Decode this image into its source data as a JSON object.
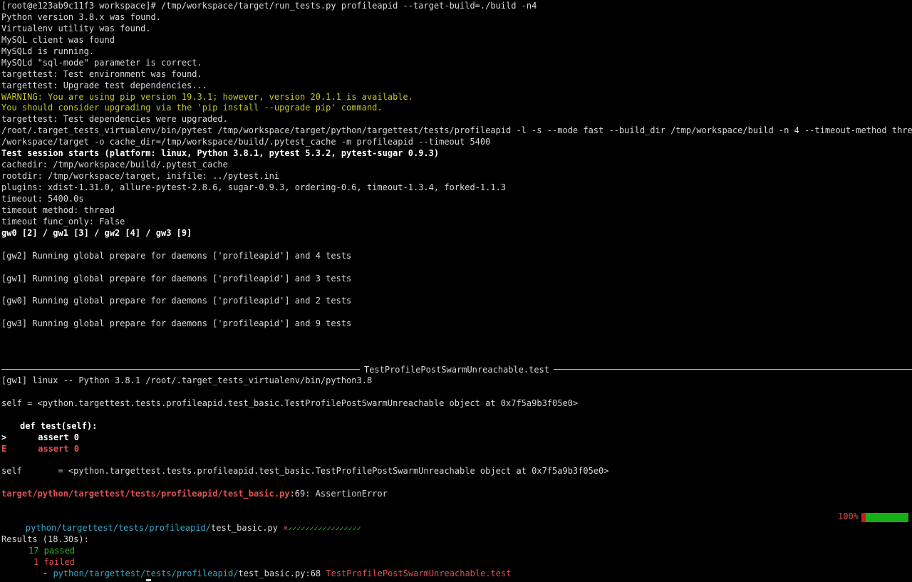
{
  "terminal": {
    "prompt": "[root@e123ab9c11f3 workspace]# /tmp/workspace/target/run_tests.py profileapid --target-build=./build -n4",
    "checks": [
      "Python version 3.8.x was found.",
      "Virtualenv utility was found.",
      "MySQL client was found",
      "MySQLd is running.",
      "MySQLd \"sql-mode\" parameter is correct.",
      "targettest: Test environment was found.",
      "targettest: Upgrade test dependencies..."
    ],
    "pip_warning": "WARNING: You are using pip version 19.3.1; however, version 20.1.1 is available.",
    "pip_upgrade": "You should consider upgrading via the 'pip install --upgrade pip' command.",
    "deps_upgraded": "targettest: Test dependencies were upgraded.",
    "pytest_cmd_1": "/root/.target_tests_virtualenv/bin/pytest /tmp/workspace/target/python/targettest/tests/profileapid -l -s --mode fast --build_dir /tmp/workspace/build -n 4 --timeout-method thread --rootdir /tmp",
    "pytest_cmd_2": "/workspace/target -o cache_dir=/tmp/workspace/build/.pytest_cache -m profileapid --timeout 5400",
    "session_start": "Test session starts (platform: linux, Python 3.8.1, pytest 5.3.2, pytest-sugar 0.9.3)",
    "session_info": [
      "cachedir: /tmp/workspace/build/.pytest_cache",
      "rootdir: /tmp/workspace/target, inifile: ../pytest.ini",
      "plugins: xdist-1.31.0, allure-pytest-2.8.6, sugar-0.9.3, ordering-0.6, timeout-1.3.4, forked-1.1.3",
      "timeout: 5400.0s",
      "timeout method: thread",
      "timeout func_only: False"
    ],
    "workers": "gw0 [2] / gw1 [3] / gw2 [4] / gw3 [9]",
    "prepare": [
      "[gw2] Running global prepare for daemons ['profileapid'] and 4 tests",
      "[gw1] Running global prepare for daemons ['profileapid'] and 3 tests",
      "[gw0] Running global prepare for daemons ['profileapid'] and 2 tests",
      "[gw3] Running global prepare for daemons ['profileapid'] and 9 tests"
    ],
    "failure_header": "TestProfilePostSwarmUnreachable.test",
    "worker_python": "[gw1] linux -- Python 3.8.1 /root/.target_tests_virtualenv/bin/python3.8",
    "self_repr": "self = <python.targettest.tests.profileapid.test_basic.TestProfilePostSwarmUnreachable object at 0x7f5a9b3f05e0>",
    "def_line": "def test(self):",
    "marker_current": ">",
    "marker_error": "E",
    "assert_line": "assert 0",
    "locals_self": "self       = <python.targettest.tests.profileapid.test_basic.TestProfilePostSwarmUnreachable object at 0x7f5a9b3f05e0>",
    "error_location": "target/python/targettest/tests/profileapid/test_basic.py",
    "error_suffix": ":69: AssertionError",
    "progress_path": "python/targettest/tests/profileapid/",
    "progress_file": "test_basic.py",
    "progress_marks_fail": "⨯",
    "progress_marks_pass": "✓✓✓✓✓✓✓✓✓✓✓✓✓✓✓✓✓",
    "progress_pct": "100%",
    "progress_fraction": 1.0,
    "results_header": "Results (18.30s):",
    "passed": "17 passed",
    "failed": "1 failed",
    "failed_item_dash": "- ",
    "failed_item_path": "python/targettest/tests/profileapid/",
    "failed_item_file": "test_basic.py:68",
    "failed_item_test": "TestProfilePostSwarmUnreachable.test"
  },
  "colors": {
    "background": "#000000",
    "text": "#d9d9d9",
    "warning": "#c5c531",
    "error": "#e05050",
    "pass": "#2fbf2f",
    "path": "#37a9c9"
  }
}
